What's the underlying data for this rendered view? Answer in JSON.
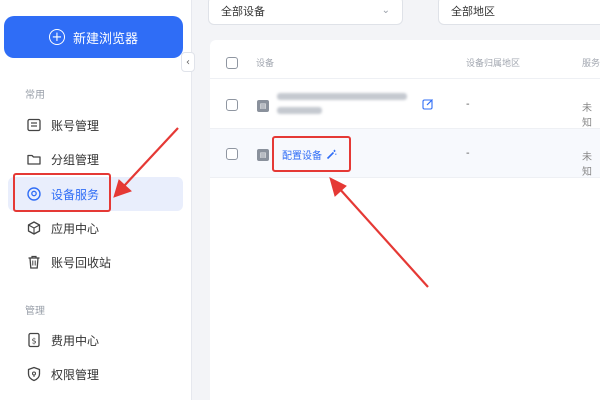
{
  "sidebar": {
    "new_browser_label": "新建浏览器",
    "collapse_glyph": "‹",
    "section_common": "常用",
    "section_manage": "管理",
    "items": [
      {
        "label": "账号管理",
        "icon": "document-list-icon"
      },
      {
        "label": "分组管理",
        "icon": "folder-icon"
      },
      {
        "label": "设备服务",
        "icon": "location-pin-icon",
        "active": true
      },
      {
        "label": "应用中心",
        "icon": "cube-icon"
      },
      {
        "label": "账号回收站",
        "icon": "trash-icon"
      },
      {
        "label": "费用中心",
        "icon": "dollar-doc-icon"
      },
      {
        "label": "权限管理",
        "icon": "shield-icon"
      }
    ]
  },
  "filters": {
    "device": "全部设备",
    "region": "全部地区"
  },
  "table": {
    "headers": [
      "设备",
      "设备归属地区",
      "服务"
    ],
    "rows": [
      {
        "device": "",
        "region": "-",
        "status": "未知"
      },
      {
        "device": "配置设备",
        "region": "-",
        "status": "未知"
      }
    ]
  },
  "colors": {
    "accent": "#2f6df6",
    "highlight": "#e53935"
  }
}
